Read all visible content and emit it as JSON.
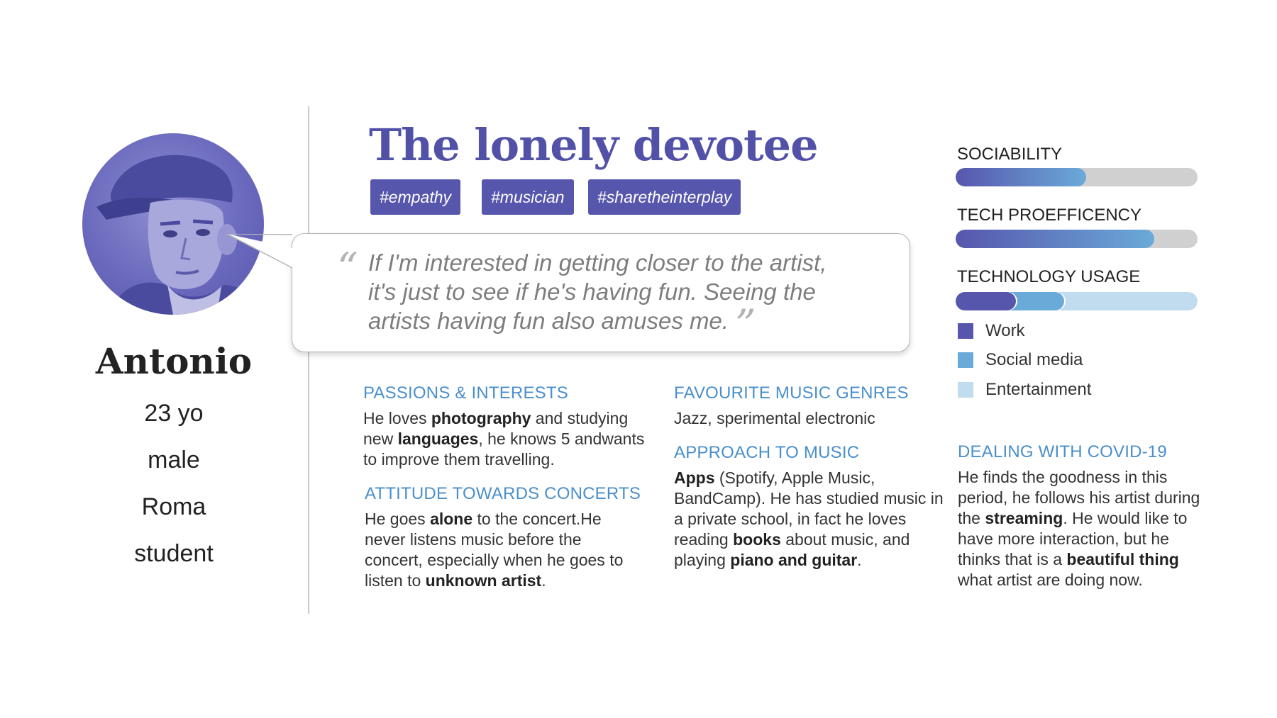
{
  "persona": {
    "name": "Antonio",
    "age": "23 yo",
    "gender": "male",
    "city": "Roma",
    "occupation": "student"
  },
  "title": "The lonely devotee",
  "tags": [
    "#empathy",
    "#musician",
    "#sharetheinterplay"
  ],
  "quote": {
    "open_mark": "“",
    "close_mark": "”",
    "lines": [
      "If I'm interested in getting closer to the artist,",
      "it's just to see if he's having fun. Seeing the",
      "artists having fun also amuses me."
    ]
  },
  "sections": {
    "passions": {
      "title": "PASSIONS & INTERESTS",
      "parts": [
        [
          "He loves ",
          false
        ],
        [
          "photography",
          true
        ],
        [
          " and studying new ",
          false
        ],
        [
          "languages",
          true
        ],
        [
          ", he knows 5 andwants to improve them travelling.",
          false
        ]
      ]
    },
    "concerts": {
      "title": "ATTITUDE TOWARDS CONCERTS",
      "parts": [
        [
          "He goes ",
          false
        ],
        [
          "alone",
          true
        ],
        [
          " to the concert.He never listens music before the concert, especially when he goes to listen to ",
          false
        ],
        [
          "unknown artist",
          true
        ],
        [
          ".",
          false
        ]
      ]
    },
    "genres": {
      "title": "FAVOURITE MUSIC GENRES",
      "parts": [
        [
          "Jazz, sperimental electronic",
          false
        ]
      ]
    },
    "approach": {
      "title": "APPROACH TO MUSIC",
      "parts": [
        [
          "Apps",
          true
        ],
        [
          " (Spotify, Apple Music, BandCamp).  He has studied music in a private school, in fact he loves reading ",
          false
        ],
        [
          "books",
          true
        ],
        [
          " about music, and playing ",
          false
        ],
        [
          "piano and guitar",
          true
        ],
        [
          ".",
          false
        ]
      ]
    },
    "covid": {
      "title": "DEALING WITH COVID-19",
      "parts": [
        [
          "He finds the goodness in this period, he follows his artist during the ",
          false
        ],
        [
          "streaming",
          true
        ],
        [
          ". He would like to have more interaction, but he thinks that is a ",
          false
        ],
        [
          "beautiful thing",
          true
        ],
        [
          " what artist are doing now.",
          false
        ]
      ]
    }
  },
  "metrics": {
    "sociability": {
      "label": "SOCIABILITY",
      "value": 0.54
    },
    "tech_proficiency": {
      "label": "TECH PROEFFICENCY",
      "value": 0.82
    },
    "technology_usage": {
      "label": "TECHNOLOGY USAGE",
      "segments": [
        {
          "name": "Work",
          "share": 0.25,
          "color": "#5756ad"
        },
        {
          "name": "Social media",
          "share": 0.2,
          "color": "#6aaad8"
        },
        {
          "name": "Entertainment",
          "share": 0.55,
          "color": "#c1dcee"
        }
      ]
    }
  },
  "colors": {
    "accent_purple": "#5756ad",
    "section_blue": "#4a8fcb",
    "bar_gradient_start": "#5756ad",
    "bar_gradient_end": "#6aaad8",
    "bar_track": "#d0d0d0"
  }
}
